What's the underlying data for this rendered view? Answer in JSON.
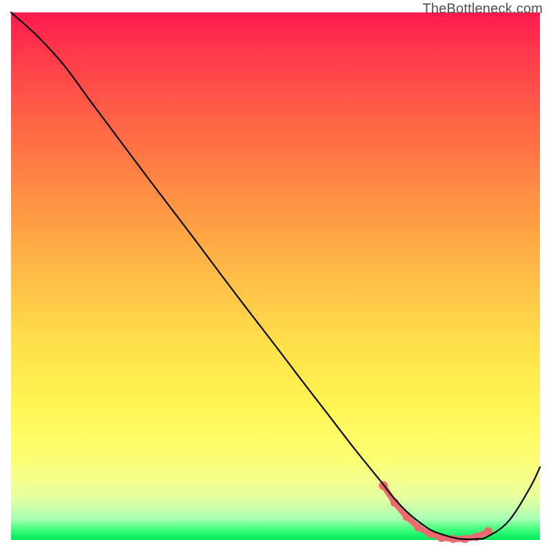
{
  "watermark": "TheBottleneck.com",
  "chart_data": {
    "type": "line",
    "title": "",
    "xlabel": "",
    "ylabel": "",
    "xlim": [
      0,
      1
    ],
    "ylim": [
      0,
      1
    ],
    "series": [
      {
        "name": "curve",
        "x": [
          0.0,
          0.05,
          0.1,
          0.15,
          0.2,
          0.25,
          0.3,
          0.35,
          0.4,
          0.45,
          0.5,
          0.55,
          0.6,
          0.65,
          0.7,
          0.72,
          0.75,
          0.78,
          0.8,
          0.83,
          0.85,
          0.88,
          0.9,
          0.94,
          0.98,
          1.0
        ],
        "y": [
          1.0,
          0.955,
          0.9,
          0.832,
          0.765,
          0.698,
          0.632,
          0.566,
          0.499,
          0.433,
          0.368,
          0.302,
          0.237,
          0.172,
          0.11,
          0.084,
          0.052,
          0.028,
          0.016,
          0.006,
          0.002,
          0.002,
          0.006,
          0.035,
          0.097,
          0.138
        ]
      }
    ],
    "markers": {
      "name": "highlight",
      "x": [
        0.704,
        0.725,
        0.748,
        0.77,
        0.792,
        0.814,
        0.836,
        0.858,
        0.88,
        0.902
      ],
      "y": [
        0.103,
        0.071,
        0.044,
        0.024,
        0.012,
        0.004,
        0.002,
        0.002,
        0.006,
        0.016
      ]
    }
  }
}
